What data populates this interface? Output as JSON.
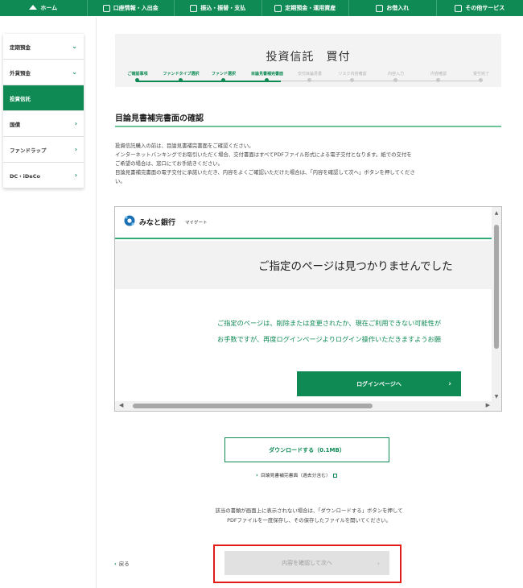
{
  "nav": {
    "items": [
      {
        "label": "ホーム",
        "icon": "home-icon"
      },
      {
        "label": "口座情報・入出金",
        "icon": "passbook-icon"
      },
      {
        "label": "振込・振替・支払",
        "icon": "transfer-icon"
      },
      {
        "label": "定期預金・運用資産",
        "icon": "piggybank-icon"
      },
      {
        "label": "お借入れ",
        "icon": "loan-icon"
      },
      {
        "label": "その他サービス",
        "icon": "grid-icon"
      }
    ]
  },
  "sidebar": {
    "items": [
      {
        "label": "定期預金",
        "chevron": "⌄"
      },
      {
        "label": "外貨預金",
        "chevron": "⌄"
      },
      {
        "label": "投資信託",
        "chevron": "",
        "active": true
      },
      {
        "label": "国債",
        "chevron": "›"
      },
      {
        "label": "ファンドラップ",
        "chevron": "›"
      },
      {
        "label": "DC・iDeCo",
        "chevron": "›"
      }
    ]
  },
  "header": {
    "title": "投資信託　買付",
    "steps": [
      {
        "label": "ご確認事項",
        "done": true
      },
      {
        "label": "ファンドタイプ選択",
        "done": true
      },
      {
        "label": "ファンド選択",
        "done": true
      },
      {
        "label": "目論見書補完書面",
        "done": true
      },
      {
        "label": "交付目論見書",
        "done": false
      },
      {
        "label": "リスク内容確認",
        "done": false
      },
      {
        "label": "内容入力",
        "done": false
      },
      {
        "label": "内容確認",
        "done": false
      },
      {
        "label": "受付完了",
        "done": false
      }
    ]
  },
  "section": {
    "title": "目論見書補完書面の確認",
    "intro": [
      "投資信託購入の前は、目論見書補完書面をご確認ください。",
      "インターネットバンキングでお取引いただく場合、交付書面はすべてPDFファイル形式による電子交付となります。紙での交付を",
      "ご希望の場合は、窓口にてお手続きください。",
      "目論見書補完書面の電子交付に承諾いただき、内容をよくご確認いただけた場合は、「内容を確認して次へ」ボタンを押してくださ",
      "い。"
    ]
  },
  "frame": {
    "bank_name": "みなと銀行",
    "bank_sub": "マイゲート",
    "error_title": "ご指定のページは見つかりませんでした",
    "error_lines": [
      "ご指定のページは、削除または変更されたか、現在ご利用できない可能性が",
      "お手数ですが、再度ログインページよりログイン操作いただきますようお願"
    ],
    "login_button": "ログインページへ",
    "login_chevron": "›",
    "scroll_up": "▲",
    "scroll_down": "▼",
    "scroll_left": "◀",
    "scroll_right": "▶"
  },
  "download": {
    "button": "ダウンロードする（0.1MB）",
    "link": "目論見書補完書面（過去分含む）",
    "chevron": "›"
  },
  "note": [
    "該当の書類が画面上に表示されない場合は、「ダウンロードする」ボタンを押して",
    "PDFファイルを一度保存し、その保存したファイルを開いてください。"
  ],
  "footer": {
    "back_label": "戻る",
    "back_chevron": "‹",
    "confirm_button": "内容を確認して次へ",
    "confirm_chevron": "›"
  },
  "colors": {
    "brand_green": "#0f8a55",
    "highlight_red": "#e21b1b",
    "disabled_gray": "#e1e1e1"
  }
}
